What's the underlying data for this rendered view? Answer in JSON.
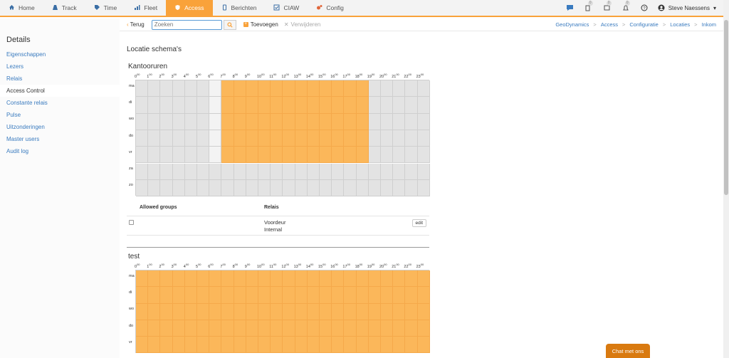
{
  "nav": {
    "items": [
      {
        "label": "Home",
        "icon": "home-icon",
        "active": false
      },
      {
        "label": "Track",
        "icon": "road-icon",
        "active": false
      },
      {
        "label": "Time",
        "icon": "tag-icon",
        "active": false
      },
      {
        "label": "Fleet",
        "icon": "chart-icon",
        "active": false
      },
      {
        "label": "Access",
        "icon": "shield-icon",
        "active": true
      },
      {
        "label": "Berichten",
        "icon": "phone-icon",
        "active": false
      },
      {
        "label": "CIAW",
        "icon": "check-icon",
        "active": false
      },
      {
        "label": "Config",
        "icon": "gears-icon",
        "active": false
      }
    ],
    "badges": [
      "0",
      "0",
      "0"
    ],
    "user": "Steve Naessens",
    "accent": "#f9a23a"
  },
  "sidebar": {
    "title": "Details",
    "items": [
      {
        "label": "Eigenschappen",
        "active": false
      },
      {
        "label": "Lezers",
        "active": false
      },
      {
        "label": "Relais",
        "active": false
      },
      {
        "label": "Access Control",
        "active": true
      },
      {
        "label": "Constante relais",
        "active": false
      },
      {
        "label": "Pulse",
        "active": false
      },
      {
        "label": "Uitzonderingen",
        "active": false
      },
      {
        "label": "Master users",
        "active": false
      },
      {
        "label": "Audit log",
        "active": false
      }
    ]
  },
  "toolbar": {
    "back": "Terug",
    "search_placeholder": "Zoeken",
    "add": "Toevoegen",
    "delete": "Verwijderen"
  },
  "breadcrumb": [
    "GeoDynamics",
    "Access",
    "Configuratie",
    "Locaties",
    "Inkom"
  ],
  "page_title": "Locatie schema's",
  "days": [
    "ma",
    "di",
    "wo",
    "do",
    "vr",
    "za",
    "zo"
  ],
  "hours": [
    "0",
    "1",
    "2",
    "3",
    "4",
    "5",
    "6",
    "7",
    "8",
    "9",
    "10",
    "11",
    "12",
    "13",
    "14",
    "15",
    "16",
    "17",
    "18",
    "19",
    "20",
    "21",
    "22",
    "23"
  ],
  "hour_suffix": "00",
  "schemas": [
    {
      "title": "Kantooruren",
      "active_days": [
        0,
        1,
        2,
        3,
        4
      ],
      "active_from": 7,
      "active_to": 19,
      "light_cells": [
        [
          0,
          6
        ],
        [
          1,
          6
        ],
        [
          2,
          6
        ],
        [
          3,
          6
        ],
        [
          4,
          6
        ]
      ],
      "groups_header": "Allowed groups",
      "relais_header": "Relais",
      "relais": [
        "Voordeur",
        "Internal"
      ],
      "edit_label": "edit"
    },
    {
      "title": "test",
      "active_days": [
        0,
        1,
        2,
        3,
        4
      ],
      "active_from": 0,
      "active_to": 24
    }
  ],
  "chat_label": "Chat met ons"
}
